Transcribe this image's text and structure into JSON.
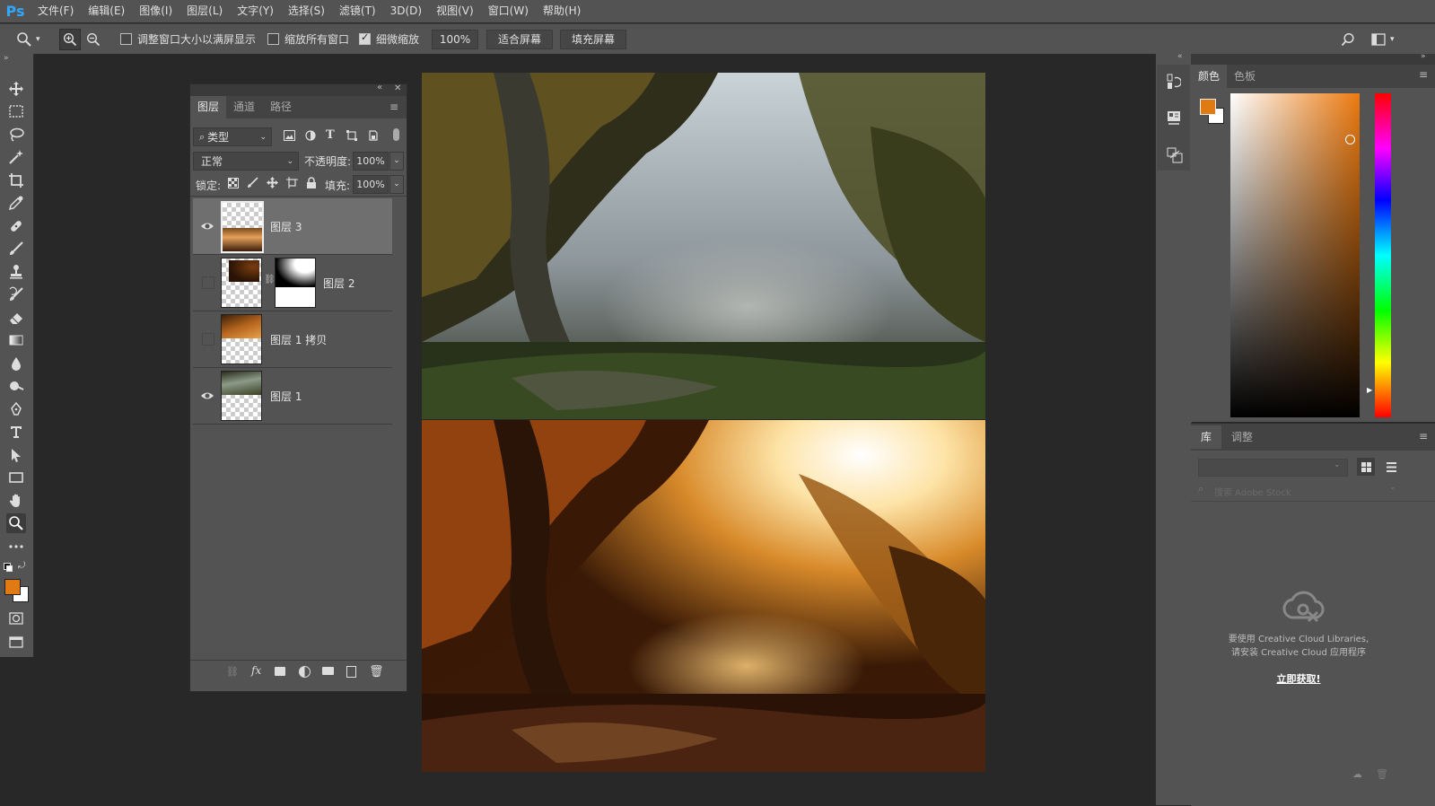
{
  "app": {
    "logo": "Ps"
  },
  "menu": [
    "文件(F)",
    "编辑(E)",
    "图像(I)",
    "图层(L)",
    "文字(Y)",
    "选择(S)",
    "滤镜(T)",
    "3D(D)",
    "视图(V)",
    "窗口(W)",
    "帮助(H)"
  ],
  "options": {
    "resize_windows": "调整窗口大小以满屏显示",
    "resize_windows_checked": false,
    "zoom_all": "缩放所有窗口",
    "zoom_all_checked": false,
    "scrubby_zoom": "细微缩放",
    "scrubby_zoom_checked": true,
    "zoom_value": "100%",
    "fit_screen": "适合屏幕",
    "fill_screen": "填充屏幕"
  },
  "layers_panel": {
    "tabs": [
      "图层",
      "通道",
      "路径"
    ],
    "active_tab": 0,
    "filter_kind": "类型",
    "blend_mode": "正常",
    "opacity_label": "不透明度:",
    "opacity_value": "100%",
    "lock_label": "锁定:",
    "fill_label": "填充:",
    "fill_value": "100%",
    "layers": [
      {
        "name": "图层 3",
        "visible": true,
        "selected": true
      },
      {
        "name": "图层 2",
        "visible": false,
        "selected": false,
        "has_mask": true
      },
      {
        "name": "图层 1 拷贝",
        "visible": false,
        "selected": false
      },
      {
        "name": "图层 1",
        "visible": true,
        "selected": false
      }
    ]
  },
  "color_panel": {
    "tabs": [
      "颜色",
      "色板"
    ],
    "foreground": "#e07a12",
    "background": "#ffffff"
  },
  "library_panel": {
    "tabs": [
      "库",
      "调整"
    ],
    "search_placeholder": "搜索 Adobe Stock",
    "message_line1": "要使用 Creative Cloud Libraries,",
    "message_line2": "请安装 Creative Cloud 应用程序",
    "get_link": "立即获取!"
  },
  "colors": {
    "accent_orange": "#e07a12",
    "panel": "#535353",
    "workspace": "#282828"
  }
}
